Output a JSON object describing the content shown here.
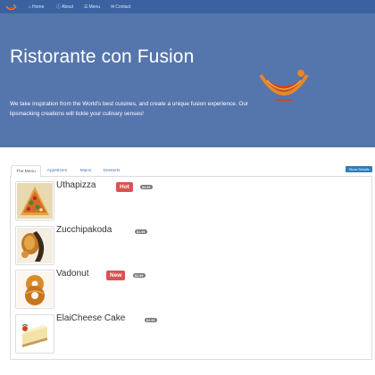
{
  "navbar": {
    "brand_icon": "restaurant-logo-icon",
    "items": [
      {
        "icon": "home-icon",
        "glyph": "⌂",
        "label": "Home"
      },
      {
        "icon": "info-icon",
        "glyph": "ⓘ",
        "label": "About"
      },
      {
        "icon": "list-icon",
        "glyph": "☰",
        "label": "Menu"
      },
      {
        "icon": "envelope-icon",
        "glyph": "✉",
        "label": "Contact"
      }
    ],
    "background": "#3b61a0"
  },
  "jumbotron": {
    "title": "Ristorante con Fusion",
    "description": "We take inspiration from the World's best cuisines, and create a unique fusion experience. Our lipsmacking creations will tickle your culinary senses!",
    "background": "#5575ad"
  },
  "tabs": [
    {
      "label": "The Menu",
      "active": true
    },
    {
      "label": "Appetizers",
      "active": false
    },
    {
      "label": "Mains",
      "active": false
    },
    {
      "label": "Desserts",
      "active": false
    }
  ],
  "details_button": "Show Details",
  "dishes": [
    {
      "name": "Uthapizza",
      "label": "Hot",
      "price": "$4.99",
      "image": "pizza"
    },
    {
      "name": "Zucchipakoda",
      "label": "",
      "price": "$1.99",
      "image": "pakoda"
    },
    {
      "name": "Vadonut",
      "label": "New",
      "price": "$1.99",
      "image": "donut"
    },
    {
      "name": "ElaiCheese Cake",
      "label": "",
      "price": "$2.99",
      "image": "cheesecake"
    }
  ],
  "colors": {
    "label_red": "#d9534f",
    "badge_gray": "#777777",
    "button_blue": "#337ab7",
    "link_blue": "#4677b6"
  }
}
